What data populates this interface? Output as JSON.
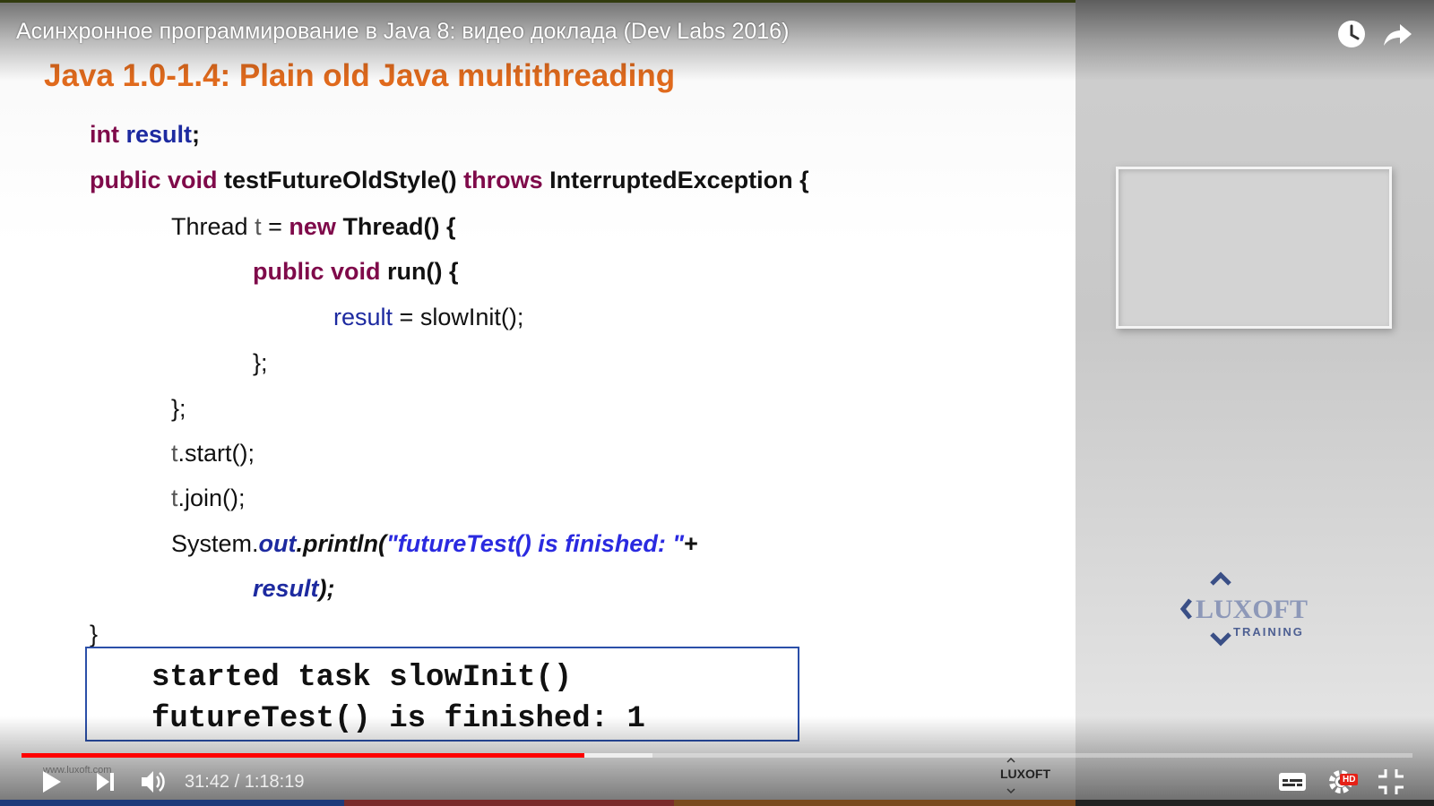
{
  "video": {
    "title": "Асинхронное программирование в Java 8: видео доклада (Dev Labs 2016)"
  },
  "slide": {
    "title": "Java 1.0-1.4: Plain old Java multithreading",
    "code": {
      "l1": {
        "kw": "int",
        "field": "result",
        "semi": ";"
      },
      "l2": {
        "kw1": "public",
        "kw2": "void",
        "method": "testFutureOldStyle()",
        "kw3": "throws",
        "rest": "InterruptedException {"
      },
      "l3": {
        "cls": "Thread",
        "var": "t",
        "eq": "=",
        "kw": "new",
        "rest": "Thread() {"
      },
      "l4": {
        "kw1": "public",
        "kw2": "void",
        "rest": "run() {"
      },
      "l5": {
        "field": "result",
        "rest": "= slowInit();"
      },
      "l6": "};",
      "l7": "};",
      "l8": {
        "var": "t",
        "rest": ".start();"
      },
      "l9": {
        "var": "t",
        "rest": ".join();"
      },
      "l10": {
        "cls": "System.",
        "out": "out",
        "println": ".println(",
        "str": "\"futureTest() is finished: \"",
        "plus": "+"
      },
      "l11": {
        "field": "result",
        "rest": ");"
      },
      "l12": "}"
    },
    "output": {
      "line1": "started task slowInit()",
      "line2": "futureTest() is finished: 1"
    }
  },
  "side_panel": {
    "logo_text": "LUXOFT",
    "logo_sub": "TRAINING"
  },
  "controls": {
    "current_time": "31:42",
    "separator": " / ",
    "duration": "1:18:19",
    "played_fraction": 0.4047,
    "buffered_fraction": 0.4536,
    "watermark_url": "www.luxoft.com",
    "luxoft_small": "LUXOFT",
    "hd_label": "HD"
  },
  "colors": {
    "accent_progress": "#ff0000",
    "slide_title": "#e06a1d",
    "keyword": "#7f0a4a",
    "field": "#1d2aa0"
  },
  "icons": {
    "play": "play-icon",
    "next": "next-icon",
    "volume": "volume-icon",
    "watch_later": "clock-icon",
    "share": "share-arrow-icon",
    "subtitles": "subtitles-icon",
    "settings": "gear-icon",
    "fullscreen": "exit-fullscreen-icon"
  }
}
